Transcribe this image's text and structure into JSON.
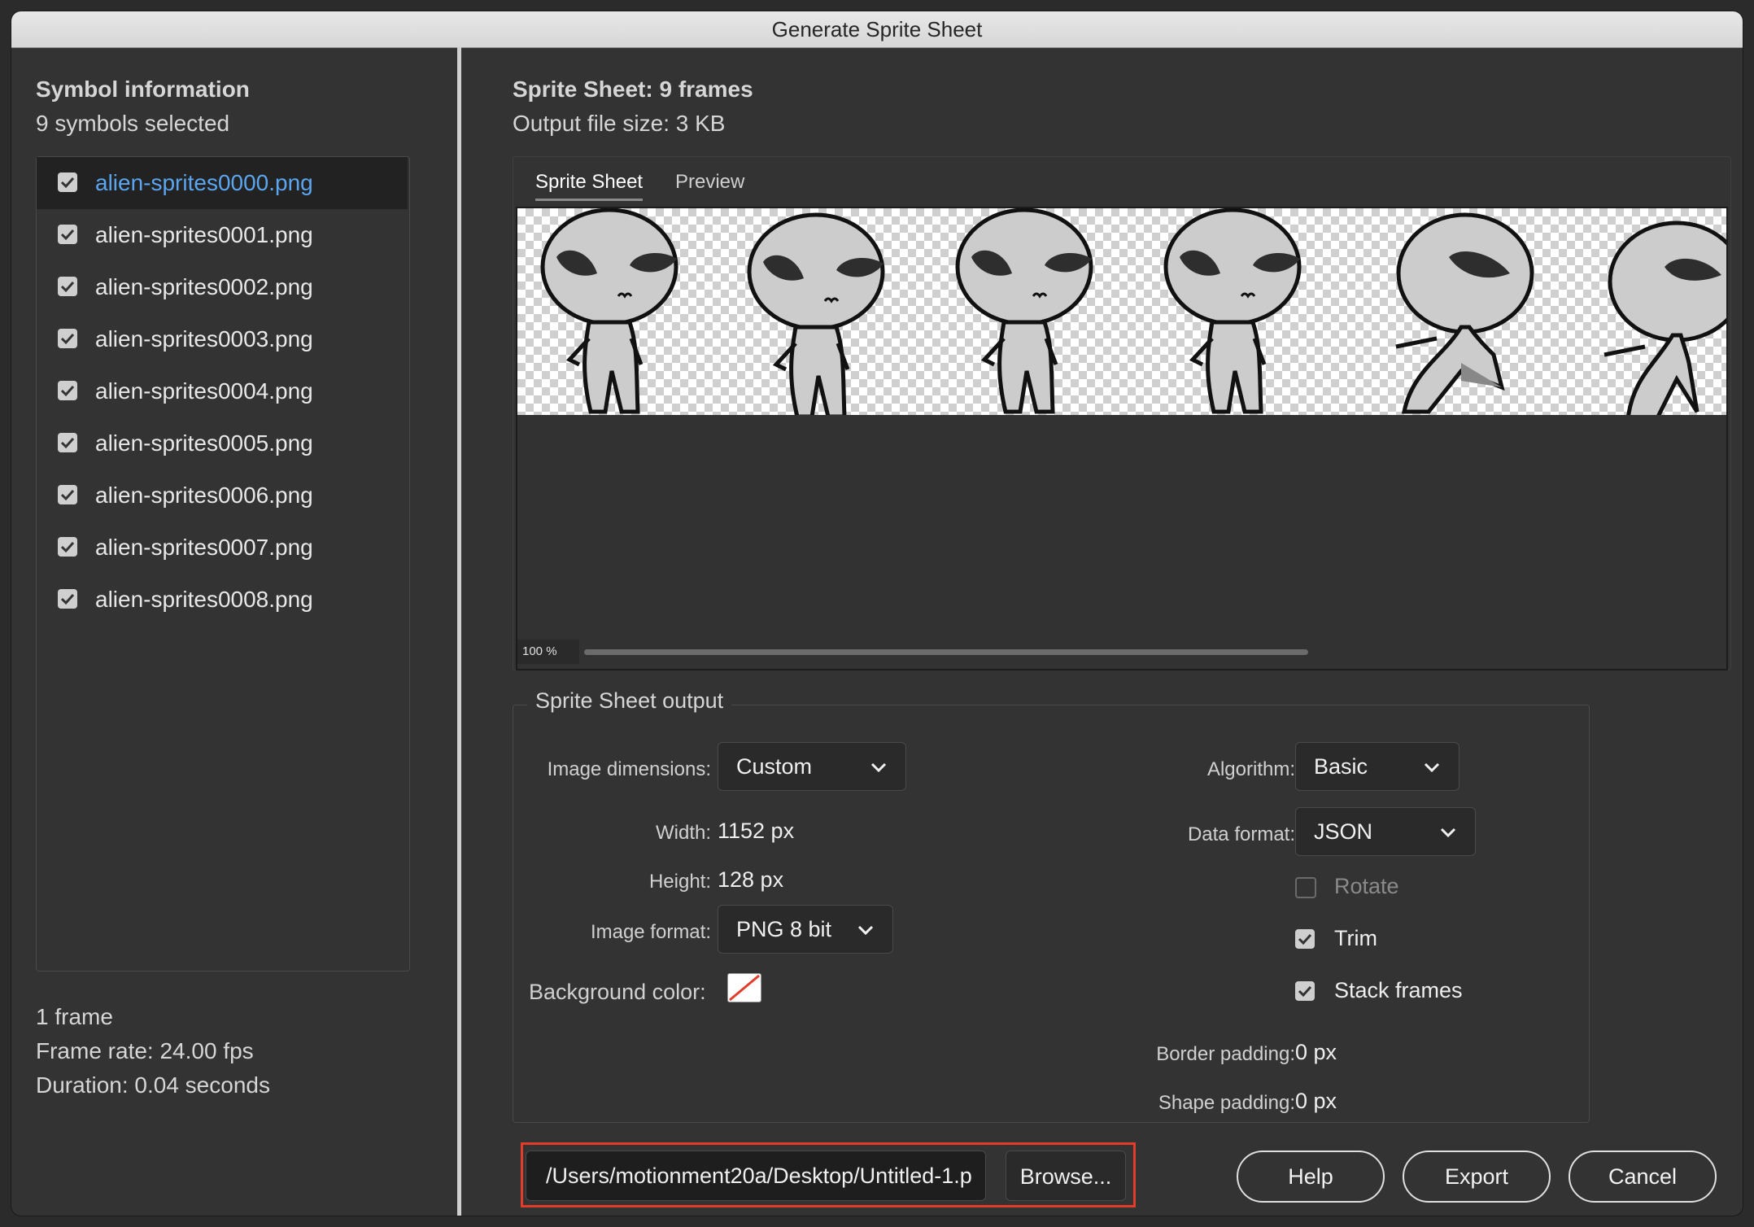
{
  "window": {
    "title": "Generate Sprite Sheet"
  },
  "symbol_info": {
    "heading": "Symbol information",
    "selected_text": "9 symbols selected",
    "items": [
      {
        "label": "alien-sprites0000.png",
        "checked": true,
        "selected": true
      },
      {
        "label": "alien-sprites0001.png",
        "checked": true,
        "selected": false
      },
      {
        "label": "alien-sprites0002.png",
        "checked": true,
        "selected": false
      },
      {
        "label": "alien-sprites0003.png",
        "checked": true,
        "selected": false
      },
      {
        "label": "alien-sprites0004.png",
        "checked": true,
        "selected": false
      },
      {
        "label": "alien-sprites0005.png",
        "checked": true,
        "selected": false
      },
      {
        "label": "alien-sprites0006.png",
        "checked": true,
        "selected": false
      },
      {
        "label": "alien-sprites0007.png",
        "checked": true,
        "selected": false
      },
      {
        "label": "alien-sprites0008.png",
        "checked": true,
        "selected": false
      }
    ],
    "frames": "1 frame",
    "frame_rate": "Frame rate: 24.00 fps",
    "duration": "Duration: 0.04 seconds"
  },
  "sprite_sheet": {
    "heading": "Sprite Sheet: 9 frames",
    "file_size": "Output file size: 3 KB",
    "tabs": [
      "Sprite Sheet",
      "Preview"
    ],
    "active_tab": "Sprite Sheet",
    "zoom": "100 %"
  },
  "output": {
    "group_title": "Sprite Sheet output",
    "image_dimensions_label": "Image dimensions:",
    "image_dimensions_value": "Custom",
    "width_label": "Width:",
    "width_value": "1152 px",
    "height_label": "Height:",
    "height_value": "128 px",
    "image_format_label": "Image format:",
    "image_format_value": "PNG 8 bit",
    "background_color_label": "Background color:",
    "algorithm_label": "Algorithm:",
    "algorithm_value": "Basic",
    "data_format_label": "Data format:",
    "data_format_value": "JSON",
    "rotate_label": "Rotate",
    "rotate_checked": false,
    "trim_label": "Trim",
    "trim_checked": true,
    "stack_frames_label": "Stack frames",
    "stack_frames_checked": true,
    "border_padding_label": "Border padding:",
    "border_padding_value": "0 px",
    "shape_padding_label": "Shape padding:",
    "shape_padding_value": "0 px"
  },
  "footer": {
    "path": "/Users/motionment20a/Desktop/Untitled-1.p",
    "browse_label": "Browse...",
    "help_label": "Help",
    "export_label": "Export",
    "cancel_label": "Cancel"
  },
  "colors": {
    "accent_selected_text": "#5aa6f0",
    "highlight_box": "#e23c2a",
    "panel_bg": "#333333"
  }
}
